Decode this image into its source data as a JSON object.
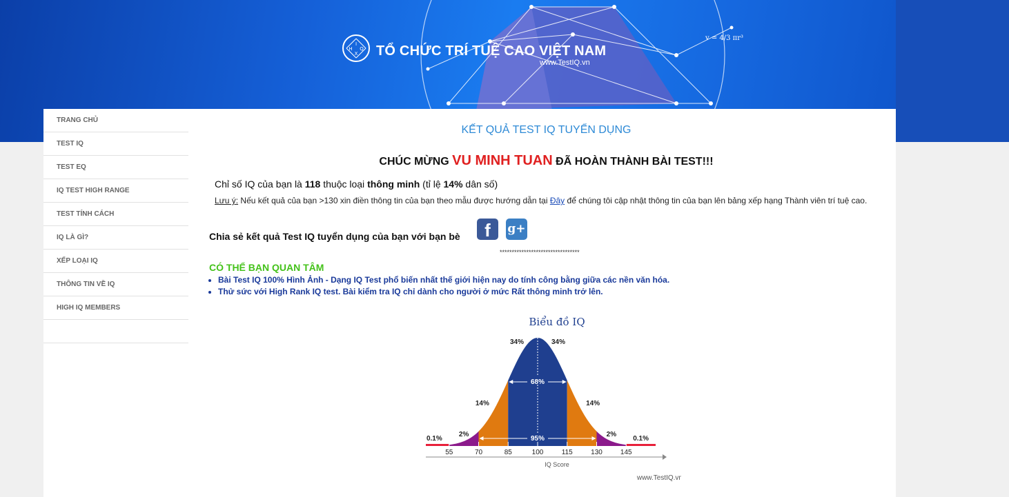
{
  "header": {
    "logo_letters": [
      "I",
      "H",
      "Q",
      "X"
    ],
    "title": "TỔ CHỨC TRÍ TUỆ CAO VIỆT NAM",
    "url": "www.TestIQ.vn",
    "formula": "v = 4/3 πr³",
    "banner_color": "#1a6fe8"
  },
  "sidebar": {
    "items": [
      {
        "label": "TRANG CHỦ"
      },
      {
        "label": "TEST IQ"
      },
      {
        "label": "TEST EQ"
      },
      {
        "label": "IQ TEST HIGH RANGE"
      },
      {
        "label": "TEST TÍNH CÁCH"
      },
      {
        "label": "IQ LÀ GÌ?"
      },
      {
        "label": "XẾP LOẠI IQ"
      },
      {
        "label": "THÔNG TIN VỀ IQ"
      },
      {
        "label": "HIGH IQ MEMBERS"
      }
    ]
  },
  "main": {
    "title": "KẾT QUẢ TEST IQ TUYỂN DỤNG",
    "congrats_prefix": "CHÚC MỪNG",
    "name": "VU MINH TUAN",
    "congrats_suffix": "ĐÃ HOÀN THÀNH BÀI TEST!!!",
    "score_p1": "Chỉ số IQ của bạn là ",
    "score_value": "118",
    "score_p2": " thuộc loại ",
    "score_class": "thông minh",
    "score_p3": " (tỉ lệ ",
    "score_pct": "14%",
    "score_p4": " dân số)",
    "note_label": "Lưu ý:",
    "note_p1": " Nếu kết quả của bạn >130 xin điền thông tin của bạn theo mẫu được hướng dẫn tại ",
    "note_link": "Đây",
    "note_p2": " để chúng tôi cập nhật thông tin của bạn lên bảng xếp hạng Thành viên trí tuệ cao.",
    "share_text": "Chia sẻ kết quả Test IQ tuyển dụng của bạn với bạn bè",
    "facebook_icon": "f",
    "gplus_icon": "g+",
    "separator": "*********************************",
    "interest_title": "CÓ THỂ BẠN QUAN TÂM",
    "links": [
      "Bài Test IQ 100% Hình Ảnh - Dạng IQ Test phổ biến nhất thế giới hiện nay do tính công bằng giữa các nền văn hóa.",
      "Thử sức với High Rank IQ test. Bài kiểm tra IQ chỉ dành cho người ở mức Rất thông minh trở lên."
    ]
  },
  "chart_data": {
    "type": "area",
    "title": "Biểu đồ IQ",
    "xlabel": "IQ Score",
    "watermark": "www.TestIQ.vn",
    "x_ticks": [
      55,
      70,
      85,
      100,
      115,
      130,
      145
    ],
    "segments": [
      {
        "label": "0.1%",
        "from": 40,
        "to": 55,
        "color": "#e8203a"
      },
      {
        "label": "2%",
        "from": 55,
        "to": 70,
        "color": "#8b1a8b"
      },
      {
        "label": "14%",
        "from": 70,
        "to": 85,
        "color": "#e07a10"
      },
      {
        "label": "34%",
        "from": 85,
        "to": 100,
        "color": "#1f3f8f"
      },
      {
        "label": "34%",
        "from": 100,
        "to": 115,
        "color": "#1f3f8f"
      },
      {
        "label": "14%",
        "from": 115,
        "to": 130,
        "color": "#e07a10"
      },
      {
        "label": "2%",
        "from": 130,
        "to": 145,
        "color": "#8b1a8b"
      },
      {
        "label": "0.1%",
        "from": 145,
        "to": 160,
        "color": "#e8203a"
      }
    ],
    "spans": [
      {
        "label": "68%",
        "from": 85,
        "to": 115
      },
      {
        "label": "95%",
        "from": 70,
        "to": 130
      }
    ]
  }
}
